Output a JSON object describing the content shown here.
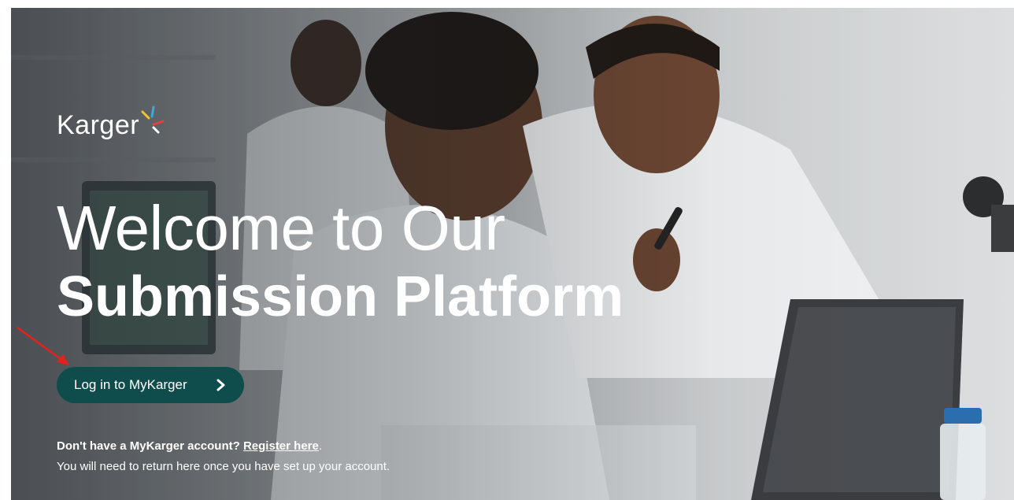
{
  "brand": {
    "name": "Karger",
    "mark_colors": [
      "#f2c230",
      "#3da8d8",
      "#e0433a",
      "#ffffff"
    ]
  },
  "hero": {
    "headline_light": "Welcome to Our",
    "headline_bold": "Submission Platform"
  },
  "login_button": {
    "label": "Log in to MyKarger",
    "icon": "chevron-right-icon",
    "bg_color": "#0f4d4d"
  },
  "register": {
    "prompt": "Don't have a MyKarger account?",
    "link_label": "Register here",
    "trailing": ".",
    "note": "You will need to return here once you have set up your account."
  },
  "annotation": {
    "icon": "red-arrow-icon",
    "color": "#e8201a"
  }
}
